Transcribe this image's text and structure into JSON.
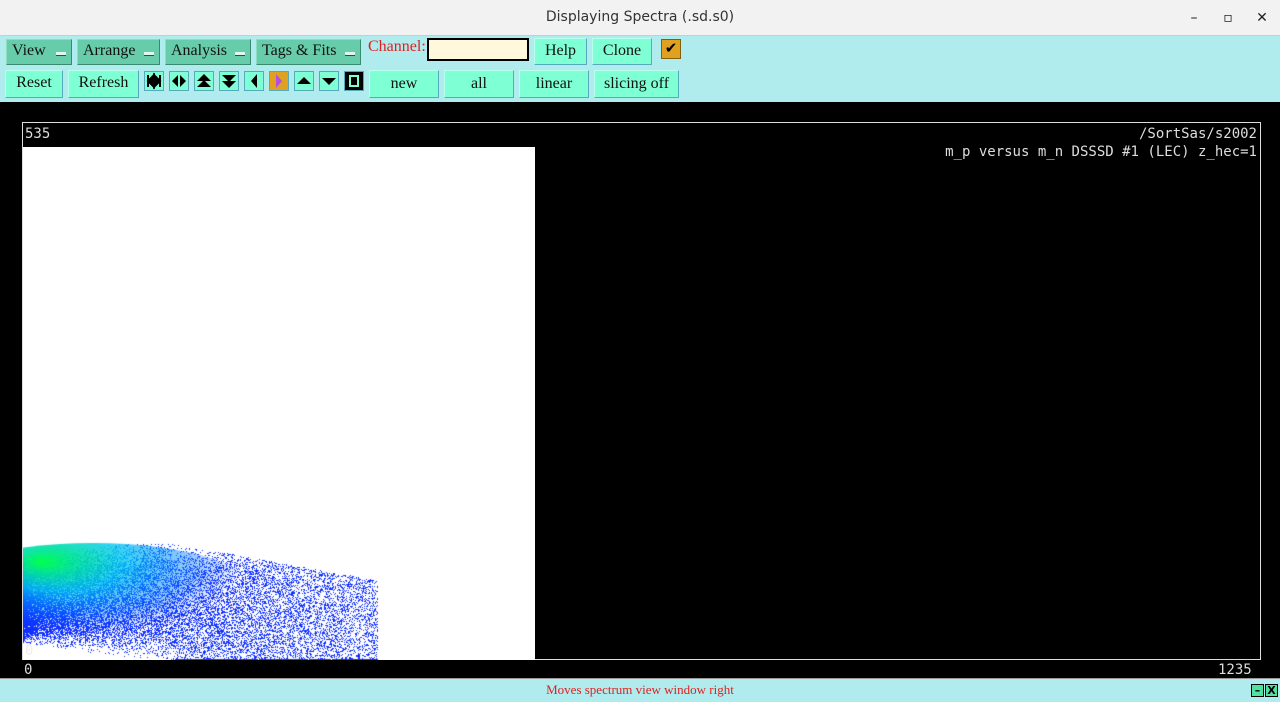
{
  "window": {
    "title": "Displaying Spectra (.sd.s0)",
    "minimize": "–",
    "maximize": "▫",
    "close": "✕"
  },
  "menus": [
    "View",
    "Arrange",
    "Analysis",
    "Tags & Fits"
  ],
  "channel": {
    "label": "Channel:",
    "value": ""
  },
  "buttons": {
    "help": "Help",
    "clone": "Clone",
    "reset": "Reset",
    "refresh": "Refresh",
    "new": "new",
    "all": "all",
    "linear": "linear",
    "slicing": "slicing off",
    "check": "✔"
  },
  "icons": [
    "expand-horizontal",
    "compress-horizontal",
    "expand-vertical",
    "compress-vertical",
    "move-left",
    "move-right",
    "move-up",
    "move-down",
    "full-view"
  ],
  "plot": {
    "y_max": "535",
    "path": "/SortSas/s2002",
    "title": "m_p versus m_n DSSSD #1 (LEC) z_hec=1",
    "y_min": "0",
    "x_min": "0",
    "x_max": "1235"
  },
  "status": {
    "text": "Moves spectrum view window right",
    "min": "–",
    "close": "X"
  }
}
